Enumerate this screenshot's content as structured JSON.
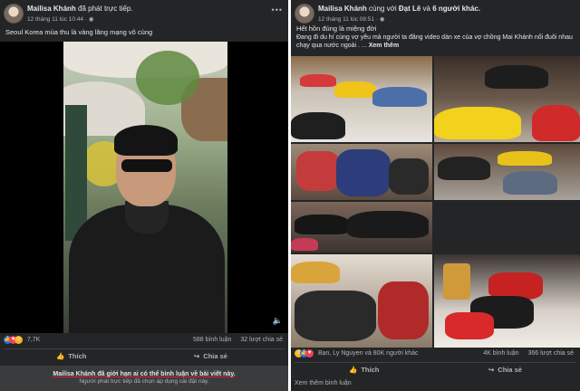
{
  "left_post": {
    "author": "Mailisa Khánh",
    "action": "đã phát trực tiếp.",
    "time": "12 tháng 11 lúc 10:44 ·",
    "caption": "Seoul Korea mùa thu là vàng lăng mạng vô cùng",
    "reaction_count": "7,7K",
    "comments": "588 bình luận",
    "shares": "32 lượt chia sẻ",
    "like_label": "Thích",
    "share_label": "Chia sẻ",
    "notice_bold": "Mailisa Khánh đã giới hạn ai có thể bình luận về bài viết này.",
    "notice_sub": "Người phát trực tiếp đã chọn áp dụng cài đặt này.",
    "more_icon": "ellipsis-icon",
    "sound_icon": "speaker-icon"
  },
  "right_post": {
    "author": "Mailisa Khánh",
    "with_text": "cùng với",
    "tag1": "Đạt Lê",
    "and_text": "và",
    "tag2": "6 người khác.",
    "time": "12 tháng 11 lúc 08:51 ·",
    "caption_line1": "Hết hồn đúng là miệng đời",
    "caption_line2": "Đang đi du hí cùng vợ yêu mà người ta đăng video dàn xe của vợ chồng Mai Khánh nối đuôi nhau chạy qua nước ngoài . ...",
    "see_more": "Xem thêm",
    "reaction_text": "Bạn, Ly Nguyen và 80K người khác",
    "comments": "4K bình luận",
    "shares": "366 lượt chia sẻ",
    "like_label": "Thích",
    "share_label": "Chia sẻ",
    "see_comments": "Xem thêm bình luận"
  },
  "colors": {
    "panel_bg": "#242526",
    "text": "#e4e6eb",
    "muted": "#b0b3b8",
    "like_blue": "#1877f2",
    "notice_bg": "#3a3b3c"
  }
}
